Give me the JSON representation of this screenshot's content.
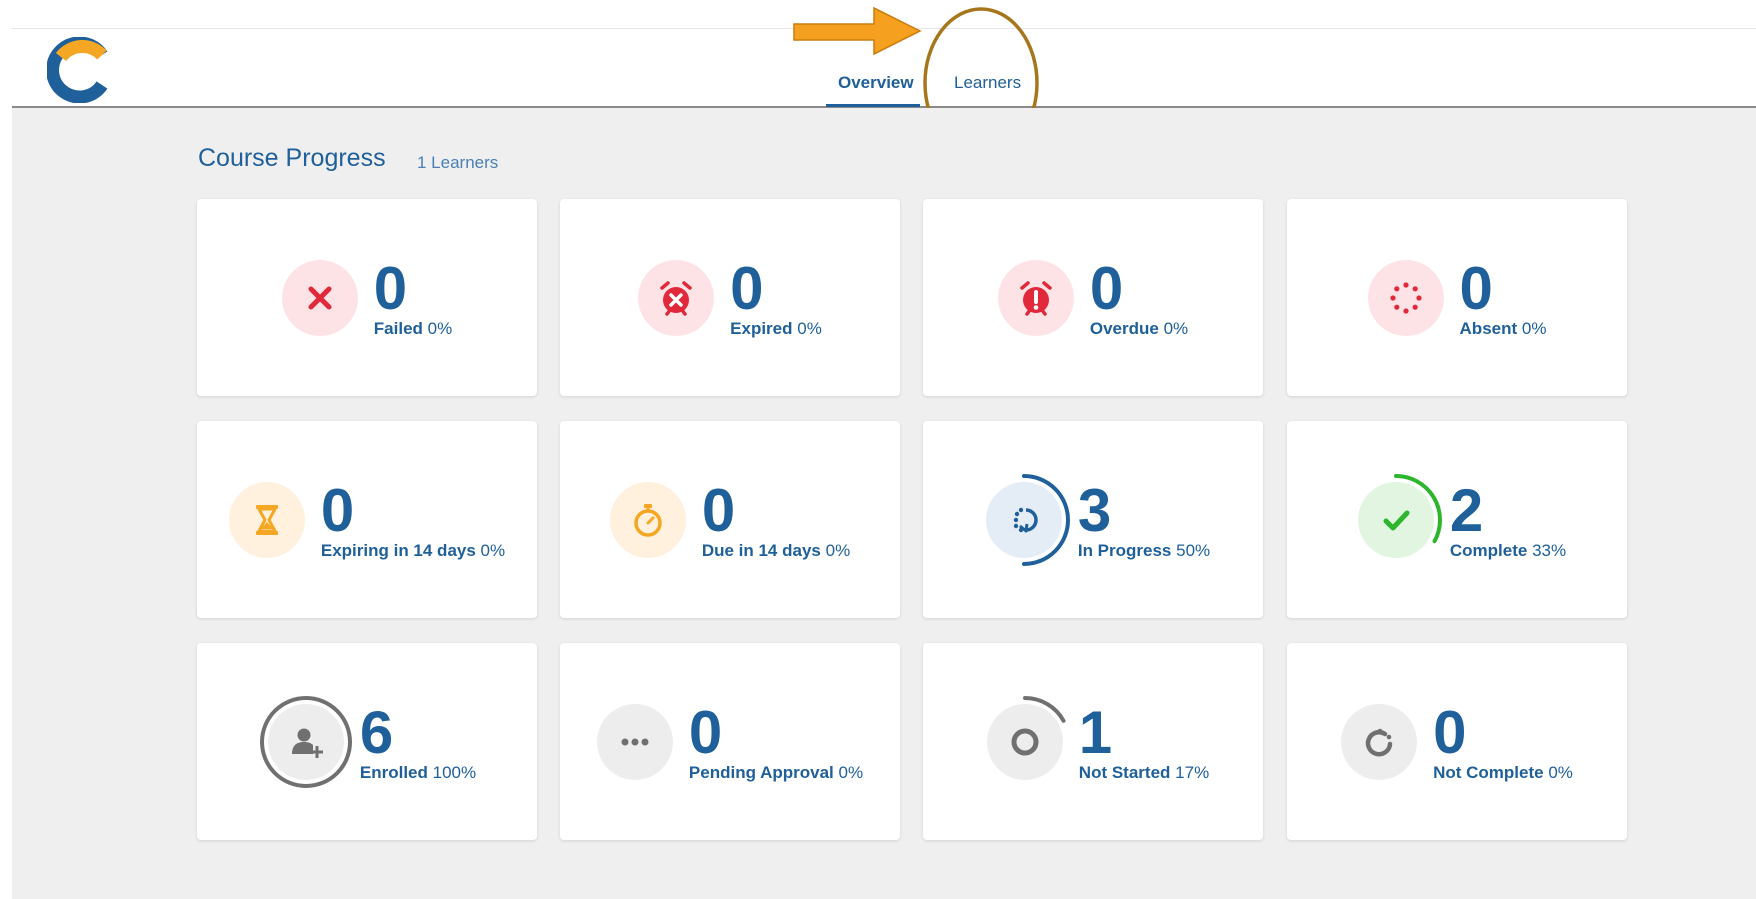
{
  "nav": {
    "logo": "c-logo-icon",
    "tabs": [
      {
        "label": "Overview",
        "active": true
      },
      {
        "label": "Learners",
        "active": false
      }
    ]
  },
  "section": {
    "title": "Course Progress",
    "subtitle": "1 Learners"
  },
  "colors": {
    "brand_blue": "#1f5f9a",
    "red": "#e2283b",
    "orange": "#f5a623",
    "green": "#2db52d",
    "grey": "#707070",
    "annotation_arrow": "#f5a01e",
    "annotation_ellipse": "#a6761d"
  },
  "cards": [
    {
      "count": "0",
      "label": "Failed",
      "pct": "0%",
      "icon": "x-icon",
      "tone": "red"
    },
    {
      "count": "0",
      "label": "Expired",
      "pct": "0%",
      "icon": "alarm-x-icon",
      "tone": "red"
    },
    {
      "count": "0",
      "label": "Overdue",
      "pct": "0%",
      "icon": "alarm-exclamation-icon",
      "tone": "red"
    },
    {
      "count": "0",
      "label": "Absent",
      "pct": "0%",
      "icon": "dotted-circle-icon",
      "tone": "red"
    },
    {
      "count": "0",
      "label": "Expiring in 14 days",
      "pct": "0%",
      "icon": "hourglass-icon",
      "tone": "orange"
    },
    {
      "count": "0",
      "label": "Due in 14 days",
      "pct": "0%",
      "icon": "stopwatch-icon",
      "tone": "orange"
    },
    {
      "count": "3",
      "label": "In Progress",
      "pct": "50%",
      "icon": "progress-arrow-icon",
      "tone": "blue",
      "fraction": 0.5
    },
    {
      "count": "2",
      "label": "Complete",
      "pct": "33%",
      "icon": "checkmark-icon",
      "tone": "green",
      "fraction": 0.33
    },
    {
      "count": "6",
      "label": "Enrolled",
      "pct": "100%",
      "icon": "add-user-icon",
      "tone": "grey",
      "fraction": 1.0
    },
    {
      "count": "0",
      "label": "Pending Approval",
      "pct": "0%",
      "icon": "ellipsis-icon",
      "tone": "grey"
    },
    {
      "count": "1",
      "label": "Not Started",
      "pct": "17%",
      "icon": "empty-circle-icon",
      "tone": "grey",
      "fraction": 0.17
    },
    {
      "count": "0",
      "label": "Not Complete",
      "pct": "0%",
      "icon": "partial-circle-icon",
      "tone": "grey"
    }
  ]
}
